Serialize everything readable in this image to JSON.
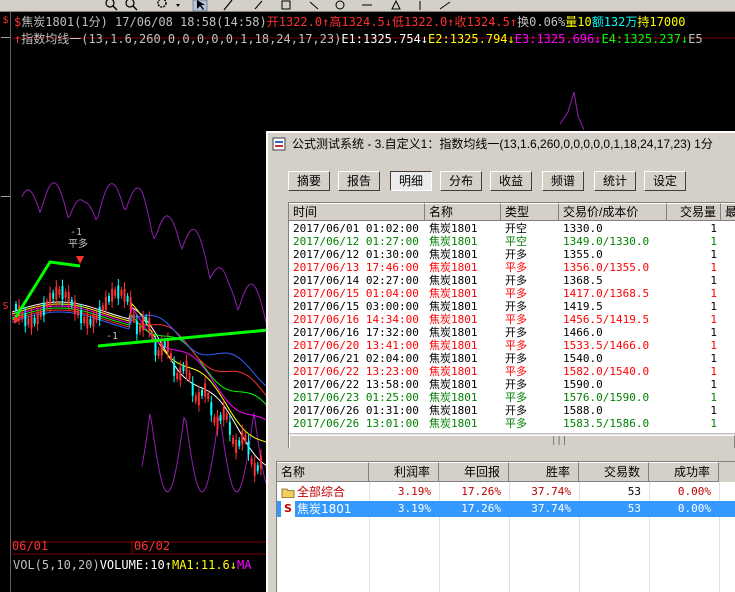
{
  "toolbar": {
    "icons": [
      "zoom-in-icon",
      "zoom-out-icon",
      "settings-icon",
      "cursor-icon",
      "line-tool-icon"
    ]
  },
  "leftbar": {
    "marks": [
      "$",
      "S"
    ]
  },
  "chart_header": {
    "line1": [
      {
        "text": "$",
        "color": "#ff3030"
      },
      {
        "text": "焦炭1801(1分) 17/06/08 18:58(14:58)",
        "color": "#c0c0c0"
      },
      {
        "text": "开1322.0",
        "color": "#ff3030"
      },
      {
        "text": "↑",
        "color": "#ff3030"
      },
      {
        "text": "高1324.5",
        "color": "#ff3030"
      },
      {
        "text": "↓",
        "color": "#ff3030"
      },
      {
        "text": "低1322.0",
        "color": "#ff3030"
      },
      {
        "text": "↑",
        "color": "#ff3030"
      },
      {
        "text": "收1324.5",
        "color": "#ff3030"
      },
      {
        "text": "↑",
        "color": "#ff3030"
      },
      {
        "text": "换0.06%",
        "color": "#c0c0c0"
      },
      {
        "text": "量10",
        "color": "#ffff00"
      },
      {
        "text": "额132万",
        "color": "#00ffff"
      },
      {
        "text": "持17000",
        "color": "#ffff00"
      }
    ],
    "line2": [
      {
        "text": "↑",
        "color": "#ff3030"
      },
      {
        "text": "指数均线一(13,1.6,260,0,0,0,0,0,1,18,24,17,23)",
        "color": "#c0c0c0"
      },
      {
        "text": "E1:1325.754",
        "color": "#ffffff"
      },
      {
        "text": "↓",
        "color": "#ffffff"
      },
      {
        "text": "E2:1325.794",
        "color": "#ffff00"
      },
      {
        "text": "↓",
        "color": "#ffff00"
      },
      {
        "text": "E3:1325.696",
        "color": "#ff00ff"
      },
      {
        "text": "↓",
        "color": "#ff00ff"
      },
      {
        "text": "E4:1325.237",
        "color": "#00ff00"
      },
      {
        "text": "↓",
        "color": "#00ff00"
      },
      {
        "text": "E5",
        "color": "#c0c0c0"
      }
    ]
  },
  "chart_annotations": {
    "signal_minus1": "-1",
    "signal_ping_duo": "平多",
    "signal_ping_duo2": "-1",
    "date_labels": [
      "06/01",
      "06/02"
    ],
    "volume_line": [
      {
        "text": "VOL(5,10,20)",
        "color": "#c0c0c0"
      },
      {
        "text": "VOLUME:10",
        "color": "#ffffff"
      },
      {
        "text": "↑",
        "color": "#ffffff"
      },
      {
        "text": "MA1:11.6",
        "color": "#ffff00"
      },
      {
        "text": "↓",
        "color": "#ffff00"
      },
      {
        "text": "MA",
        "color": "#ff00ff"
      }
    ]
  },
  "dialog": {
    "title": "公式测试系统 - 3.自定义1：指数均线一(13,1.6,260,0,0,0,0,0,1,18,24,17,23) 1分",
    "tabs": [
      {
        "label": "摘要",
        "active": false
      },
      {
        "label": "报告",
        "active": false
      },
      {
        "label": "明细",
        "active": true
      },
      {
        "label": "分布",
        "active": false
      },
      {
        "label": "收益",
        "active": false
      },
      {
        "label": "频谱",
        "active": false
      },
      {
        "label": "统计",
        "active": false
      },
      {
        "label": "设定",
        "active": false
      }
    ],
    "detail": {
      "columns": [
        "时间",
        "名称",
        "类型",
        "交易价/成本价",
        "交易量",
        "最"
      ],
      "rows": [
        {
          "time": "2017/06/01 01:02:00",
          "name": "焦炭1801",
          "type": "开空",
          "price": "1330.0",
          "qty": "1",
          "color": "#000000"
        },
        {
          "time": "2017/06/12 01:27:00",
          "name": "焦炭1801",
          "type": "平空",
          "price": "1349.0/1330.0",
          "qty": "1",
          "color": "#008000"
        },
        {
          "time": "2017/06/12 01:30:00",
          "name": "焦炭1801",
          "type": "开多",
          "price": "1355.0",
          "qty": "1",
          "color": "#000000"
        },
        {
          "time": "2017/06/13 17:46:00",
          "name": "焦炭1801",
          "type": "平多",
          "price": "1356.0/1355.0",
          "qty": "1",
          "color": "#ff0000"
        },
        {
          "time": "2017/06/14 02:27:00",
          "name": "焦炭1801",
          "type": "开多",
          "price": "1368.5",
          "qty": "1",
          "color": "#000000"
        },
        {
          "time": "2017/06/15 01:04:00",
          "name": "焦炭1801",
          "type": "平多",
          "price": "1417.0/1368.5",
          "qty": "1",
          "color": "#ff0000"
        },
        {
          "time": "2017/06/15 03:00:00",
          "name": "焦炭1801",
          "type": "开多",
          "price": "1419.5",
          "qty": "1",
          "color": "#000000"
        },
        {
          "time": "2017/06/16 14:34:00",
          "name": "焦炭1801",
          "type": "平多",
          "price": "1456.5/1419.5",
          "qty": "1",
          "color": "#ff0000"
        },
        {
          "time": "2017/06/16 17:32:00",
          "name": "焦炭1801",
          "type": "开多",
          "price": "1466.0",
          "qty": "1",
          "color": "#000000"
        },
        {
          "time": "2017/06/20 13:41:00",
          "name": "焦炭1801",
          "type": "平多",
          "price": "1533.5/1466.0",
          "qty": "1",
          "color": "#ff0000"
        },
        {
          "time": "2017/06/21 02:04:00",
          "name": "焦炭1801",
          "type": "开多",
          "price": "1540.0",
          "qty": "1",
          "color": "#000000"
        },
        {
          "time": "2017/06/22 13:23:00",
          "name": "焦炭1801",
          "type": "平多",
          "price": "1582.0/1540.0",
          "qty": "1",
          "color": "#ff0000"
        },
        {
          "time": "2017/06/22 13:58:00",
          "name": "焦炭1801",
          "type": "开多",
          "price": "1590.0",
          "qty": "1",
          "color": "#000000"
        },
        {
          "time": "2017/06/23 01:25:00",
          "name": "焦炭1801",
          "type": "平多",
          "price": "1576.0/1590.0",
          "qty": "1",
          "color": "#008000"
        },
        {
          "time": "2017/06/26 01:31:00",
          "name": "焦炭1801",
          "type": "开多",
          "price": "1588.0",
          "qty": "1",
          "color": "#000000"
        },
        {
          "time": "2017/06/26 13:01:00",
          "name": "焦炭1801",
          "type": "平多",
          "price": "1583.5/1586.0",
          "qty": "1",
          "color": "#008000"
        }
      ],
      "scroll_grip": "|||"
    },
    "summary": {
      "columns": [
        "名称",
        "利润率",
        "年回报",
        "胜率",
        "交易数",
        "成功率"
      ],
      "rows": [
        {
          "icon": "folder-icon",
          "name": "全部综合",
          "profit": "3.19%",
          "annual": "17.26%",
          "win": "37.74%",
          "trades": "53",
          "success": "0.00%",
          "selected": false
        },
        {
          "icon": "s-icon",
          "icon_text": "S",
          "name": "焦炭1801",
          "profit": "3.19%",
          "annual": "17.26%",
          "win": "37.74%",
          "trades": "53",
          "success": "0.00%",
          "selected": true
        }
      ]
    }
  }
}
